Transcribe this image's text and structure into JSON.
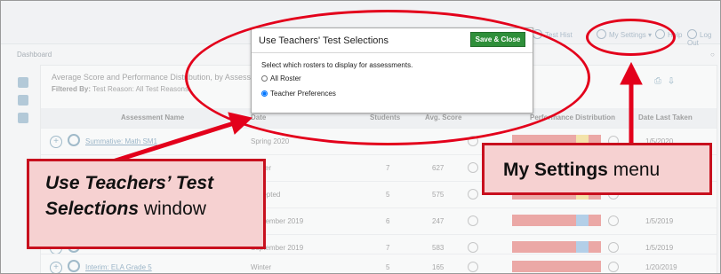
{
  "topbar": {
    "links": [
      "Test Hist",
      "My Settings ▾",
      "Help",
      "Log Out"
    ]
  },
  "breadcrumb": "Dashboard",
  "panel": {
    "title": "Average Score and Performance Distribution, by Assessment",
    "filter_label": "Filtered By:",
    "filter_value": "Test Reason: All Test Reasons",
    "columns": [
      "Assessment Name",
      "Date",
      "Students",
      "Avg. Score",
      "",
      "Performance Distribution",
      "Date Last Taken"
    ],
    "rows": [
      {
        "name": "Summative: Math SM1",
        "term": "Spring 2020",
        "students": "",
        "score": "",
        "date": "1/5/2020"
      },
      {
        "name": "",
        "term": "Winter",
        "students": "7",
        "score": "627",
        "date": ""
      },
      {
        "name": "",
        "term": "Accepted",
        "students": "5",
        "score": "575",
        "date": ""
      },
      {
        "name": "",
        "term": "September 2019",
        "students": "6",
        "score": "247",
        "date": "1/5/2019"
      },
      {
        "name": "",
        "term": "September 2019",
        "students": "7",
        "score": "583",
        "date": "1/5/2019"
      },
      {
        "name": "Interim: ELA Grade 5",
        "term": "Winter",
        "students": "5",
        "score": "165",
        "date": "1/20/2019"
      }
    ]
  },
  "modal": {
    "title": "Use Teachers' Test Selections",
    "save_button": "Save & Close",
    "prompt": "Select which rosters to display for assessments.",
    "options": [
      "All Roster",
      "Teacher Preferences"
    ],
    "selected": "Teacher Preferences"
  },
  "callouts": {
    "left_italic_line1": "Use Teachers’ Test",
    "left_italic_line2": "Selections",
    "left_plain": "window",
    "right_bold": "My Settings",
    "right_plain": "menu"
  },
  "colors": {
    "highlight_red": "#e3001b",
    "callout_fill": "#f6d1d1",
    "save_green": "#2f8f3a"
  }
}
